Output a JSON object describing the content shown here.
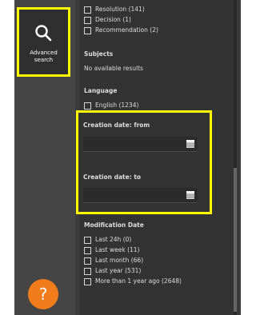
{
  "sidebar": {
    "advanced_search": {
      "icon": "search-icon",
      "label": "Advanced\nsearch"
    },
    "help": {
      "icon": "help-icon",
      "label": "?",
      "color": "#f07c1c"
    }
  },
  "filters": {
    "doc_types": [
      {
        "label": "Resolution (141)",
        "checked": false
      },
      {
        "label": "Decision (1)",
        "checked": false
      },
      {
        "label": "Recommendation (2)",
        "checked": false
      }
    ],
    "subjects": {
      "heading": "Subjects",
      "empty_text": "No available results"
    },
    "language": {
      "heading": "Language",
      "items": [
        {
          "label": "English (1234)",
          "checked": false
        }
      ]
    },
    "creation_dates": {
      "from_label": "Creation date: from",
      "to_label": "Creation date: to",
      "from_value": "",
      "to_value": ""
    },
    "modification_date": {
      "heading": "Modification Date",
      "items": [
        {
          "label": "Last 24h (0)",
          "checked": false
        },
        {
          "label": "Last week (11)",
          "checked": false
        },
        {
          "label": "Last month (66)",
          "checked": false
        },
        {
          "label": "Last year (531)",
          "checked": false
        },
        {
          "label": "More than 1 year ago (2648)",
          "checked": false
        }
      ]
    }
  },
  "colors": {
    "highlight": "#ffff00",
    "panel_bg": "#333333",
    "accent": "#f07c1c"
  }
}
